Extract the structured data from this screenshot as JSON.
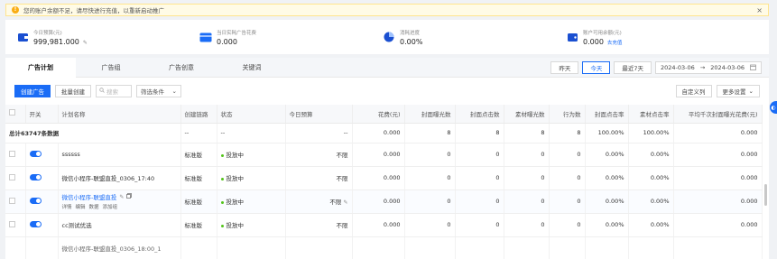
{
  "alert": {
    "message": "您的账户余额不足，请尽快进行充值，以重新启动推广",
    "close": "×"
  },
  "stats": [
    {
      "icon": "wallet-icon",
      "label": "今日预算(元)",
      "value": "999,981.000",
      "edit": true,
      "color": "#1a4fd1"
    },
    {
      "icon": "card-icon",
      "label": "当日实耗广告花费",
      "value": "0.000",
      "color": "#1a6cf6"
    },
    {
      "icon": "pie-chart-icon",
      "label": "消耗进度",
      "value": "0.00%",
      "color": "#1a4fd1"
    },
    {
      "icon": "purse-icon",
      "label": "账户可用余额(元)",
      "value": "0.000",
      "link": "去充值",
      "color": "#1a4fd1"
    }
  ],
  "tabs": [
    "广告计划",
    "广告组",
    "广告创意",
    "关键词"
  ],
  "date": {
    "yesterday": "昨天",
    "today": "今天",
    "last7": "最近7天",
    "start": "2024-03-06",
    "sep": "→",
    "end": "2024-03-06"
  },
  "toolbar": {
    "create": "创建广告",
    "batch": "批量创建",
    "search_placeholder": "搜索",
    "filter": "筛选条件",
    "custom_cols": "自定义列",
    "more": "更多设置"
  },
  "table": {
    "columns": [
      "开关",
      "计划名称",
      "创建链路",
      "状态",
      "今日预算",
      "花费(元)",
      "封面曝光数",
      "封面点击数",
      "素材曝光数",
      "行为数",
      "封面点击率",
      "素材点击率",
      "平均千次封面曝光花费(元)"
    ],
    "total": {
      "label": "总计63747条数据",
      "link": "--",
      "status": "--",
      "budget": "--",
      "cost": "0.000",
      "cover_imp": "8",
      "cover_clk": "8",
      "mat_imp": "8",
      "actions": "8",
      "cover_ctr": "100.00%",
      "mat_ctr": "100.00%",
      "cpm": "0.000"
    },
    "rows": [
      {
        "name": "ssssss",
        "link": "标准版",
        "status": "投放中",
        "budget": "不限",
        "cost": "0.000",
        "cover_imp": "0",
        "cover_clk": "0",
        "mat_imp": "0",
        "actions": "0",
        "cover_ctr": "0.00%",
        "mat_ctr": "0.00%",
        "cpm": "0.000",
        "highlight": false
      },
      {
        "name": "微信小程序-联盟直投_0306_17:40",
        "link": "标准版",
        "status": "投放中",
        "budget": "不限",
        "cost": "0.000",
        "cover_imp": "0",
        "cover_clk": "0",
        "mat_imp": "0",
        "actions": "0",
        "cover_ctr": "0.00%",
        "mat_ctr": "0.00%",
        "cpm": "0.000",
        "highlight": false
      },
      {
        "name": "微信小程序-联盟直投",
        "link": "标准版",
        "status": "投放中",
        "budget": "不限",
        "cost": "0.000",
        "cover_imp": "0",
        "cover_clk": "0",
        "mat_imp": "0",
        "actions": "0",
        "cover_ctr": "0.00%",
        "mat_ctr": "0.00%",
        "cpm": "0.000",
        "highlight": true,
        "actions_list": [
          "详情",
          "编辑",
          "数据",
          "添加组"
        ]
      },
      {
        "name": "cc测试优选",
        "link": "标准版",
        "status": "投放中",
        "budget": "不限",
        "cost": "0.000",
        "cover_imp": "0",
        "cover_clk": "0",
        "mat_imp": "0",
        "actions": "0",
        "cover_ctr": "0.00%",
        "mat_ctr": "0.00%",
        "cpm": "0.000",
        "highlight": false
      }
    ],
    "partial_row": "微信小程序-联盟直投_0306_18:00_1"
  }
}
